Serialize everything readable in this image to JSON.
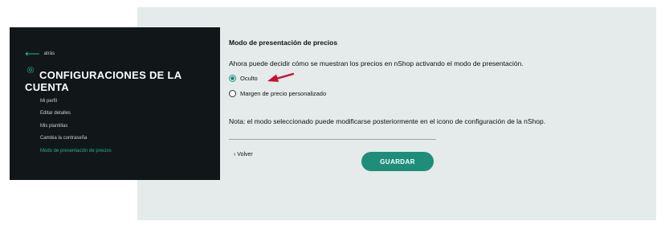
{
  "sidebar": {
    "back_label": "atrás",
    "title": "CONFIGURACIONES DE LA CUENTA",
    "items": [
      {
        "label": "Mi perfil"
      },
      {
        "label": "Editar detalles"
      },
      {
        "label": "Mis plantillas"
      },
      {
        "label": "Cambia la contraseña"
      },
      {
        "label": "Modo de presentación de precios"
      }
    ],
    "active_item": "Modo de presentación de precios"
  },
  "main": {
    "section_title": "Modo de presentación de precios",
    "description": "Ahora puede decidir cómo se muestran los precios en nShop activando el modo de presentación.",
    "options": [
      {
        "label": "Oculto",
        "selected": true
      },
      {
        "label": "Margen de precio personalizado",
        "selected": false
      }
    ],
    "note": "Nota: el modo seleccionado puede modificarse posteriormente en el icono de configuración de la nShop.",
    "back_button": "Volver",
    "save_button": "GUARDAR"
  },
  "colors": {
    "accent": "#1e8e7b",
    "sidebar_bg": "#111719",
    "content_bg": "#e5eaea",
    "annotation_arrow": "#c8102e"
  },
  "icons": [
    "back-arrow-icon",
    "gear-icon",
    "chevron-left-icon",
    "red-arrow-annotation"
  ]
}
